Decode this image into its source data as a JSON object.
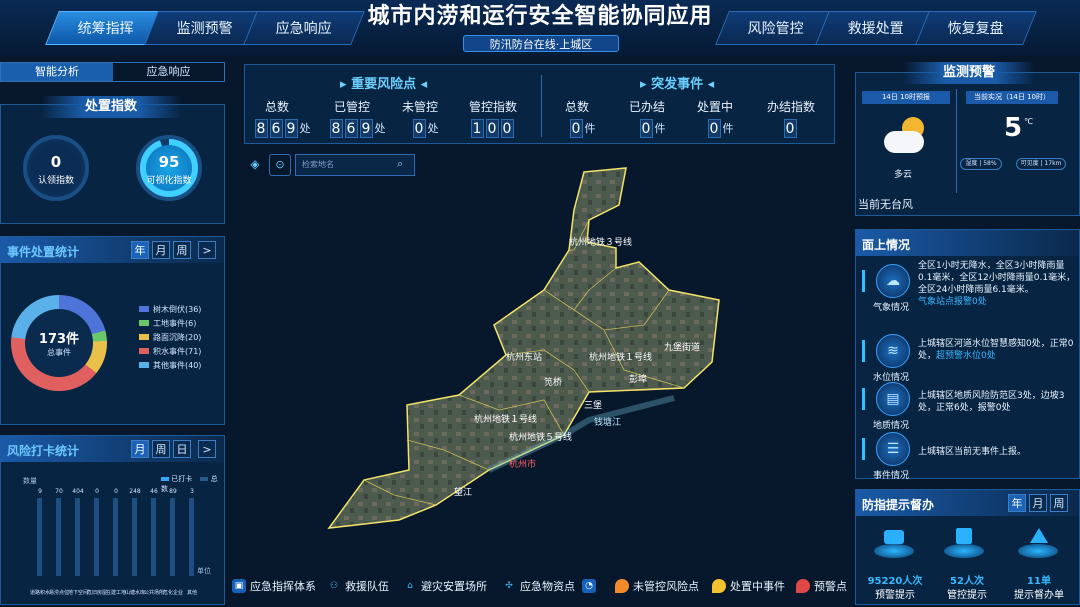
{
  "header": {
    "title": "城市内涝和运行安全智能协同应用",
    "subtitle": "防汛防台在线·上城区",
    "nav_left": [
      "统筹指挥",
      "监测预警",
      "应急响应"
    ],
    "nav_right": [
      "风险管控",
      "救援处置",
      "恢复复盘"
    ]
  },
  "left_tabs": [
    "智能分析",
    "应急响应"
  ],
  "disposal": {
    "title": "处置指数",
    "gauges": [
      {
        "value": "0",
        "label": "认领指数"
      },
      {
        "value": "95",
        "label": "可视化指数"
      }
    ]
  },
  "event_stats": {
    "title": "事件处置统计",
    "periods": [
      "年",
      "月",
      "周"
    ],
    "next": ">",
    "total": "173件",
    "total_label": "总事件",
    "legend": [
      "树木倒伏(36)",
      "工地事件(6)",
      "路面沉降(20)",
      "积水事件(71)",
      "其他事件(40)"
    ]
  },
  "risk_checkin": {
    "title": "风险打卡统计",
    "periods": [
      "月",
      "周",
      "日"
    ],
    "legend_checked": "已打卡",
    "legend_total": "总数",
    "axis_label": "数量",
    "unit": "单位",
    "values": [
      "9",
      "70",
      "404",
      "0",
      "0",
      "248",
      "46",
      "89",
      "3"
    ],
    "categories": [
      "道路积水",
      "易涝点位",
      "地下空间",
      "危旧房屋",
      "在建工地",
      "山塘水库",
      "公共场所",
      "危化企业",
      "其他"
    ]
  },
  "top_stats": {
    "risk_title": "重要风险点",
    "risk": [
      {
        "label": "总数",
        "digits": [
          "8",
          "6",
          "9"
        ],
        "unit": "处"
      },
      {
        "label": "已管控",
        "digits": [
          "8",
          "6",
          "9"
        ],
        "unit": "处"
      },
      {
        "label": "未管控",
        "digits": [
          "0"
        ],
        "unit": "处"
      },
      {
        "label": "管控指数",
        "digits": [
          "1",
          "0",
          "0"
        ],
        "unit": ""
      }
    ],
    "event_title": "突发事件",
    "events": [
      {
        "label": "总数",
        "digits": [
          "0"
        ],
        "unit": "件"
      },
      {
        "label": "已办结",
        "digits": [
          "0"
        ],
        "unit": "件"
      },
      {
        "label": "处置中",
        "digits": [
          "0"
        ],
        "unit": "件"
      },
      {
        "label": "办结指数",
        "digits": [
          "0"
        ],
        "unit": ""
      }
    ]
  },
  "map": {
    "search_placeholder": "检索地名",
    "labels": [
      "杭州地铁３号线",
      "杭州东站",
      "杭州地铁１号线",
      "九堡街道",
      "笕桥",
      "杭州市",
      "彭埠",
      "三堡",
      "杭州地铁１号线",
      "望江",
      "杭州地铁５号线",
      "钱塘江"
    ]
  },
  "bottom_legend": [
    "应急指挥体系",
    "救援队伍",
    "避灾安置场所",
    "应急物资点",
    "未管控风险点",
    "处置中事件",
    "预警点"
  ],
  "weather": {
    "title": "监测预警",
    "forecast_tag": "14日 10时预报",
    "now_tag": "当前实况（14日 10时）",
    "condition": "多云",
    "temp": "5",
    "temp_unit": "℃",
    "humidity": "湿度 | 58%",
    "visibility": "可见度 | 17km",
    "typhoon": "当前无台风"
  },
  "surface": {
    "title": "面上情况",
    "items": [
      {
        "label": "气象情况",
        "text": "全区1小时无降水，全区3小时降雨量0.1毫米，全区12小时降雨量0.1毫米，全区24小时降雨量6.1毫米。",
        "hl": "气象站点报警0处"
      },
      {
        "label": "水位情况",
        "text": "上城辖区河道水位智慧感知0处，正常0处，",
        "hl": "超预警水位0处"
      },
      {
        "label": "地质情况",
        "text": "上城辖区地质风险防范区3处，边坡3处，正常6处，报警0处",
        "hl": ""
      },
      {
        "label": "事件情况",
        "text": "上城辖区当前无事件上报。",
        "hl": ""
      }
    ]
  },
  "supervise": {
    "title": "防指提示督办",
    "periods": [
      "年",
      "月",
      "周"
    ],
    "items": [
      {
        "value": "95220人次",
        "label": "预警提示"
      },
      {
        "value": "52人次",
        "label": "管控提示"
      },
      {
        "value": "11单",
        "label": "提示督办单"
      }
    ]
  }
}
